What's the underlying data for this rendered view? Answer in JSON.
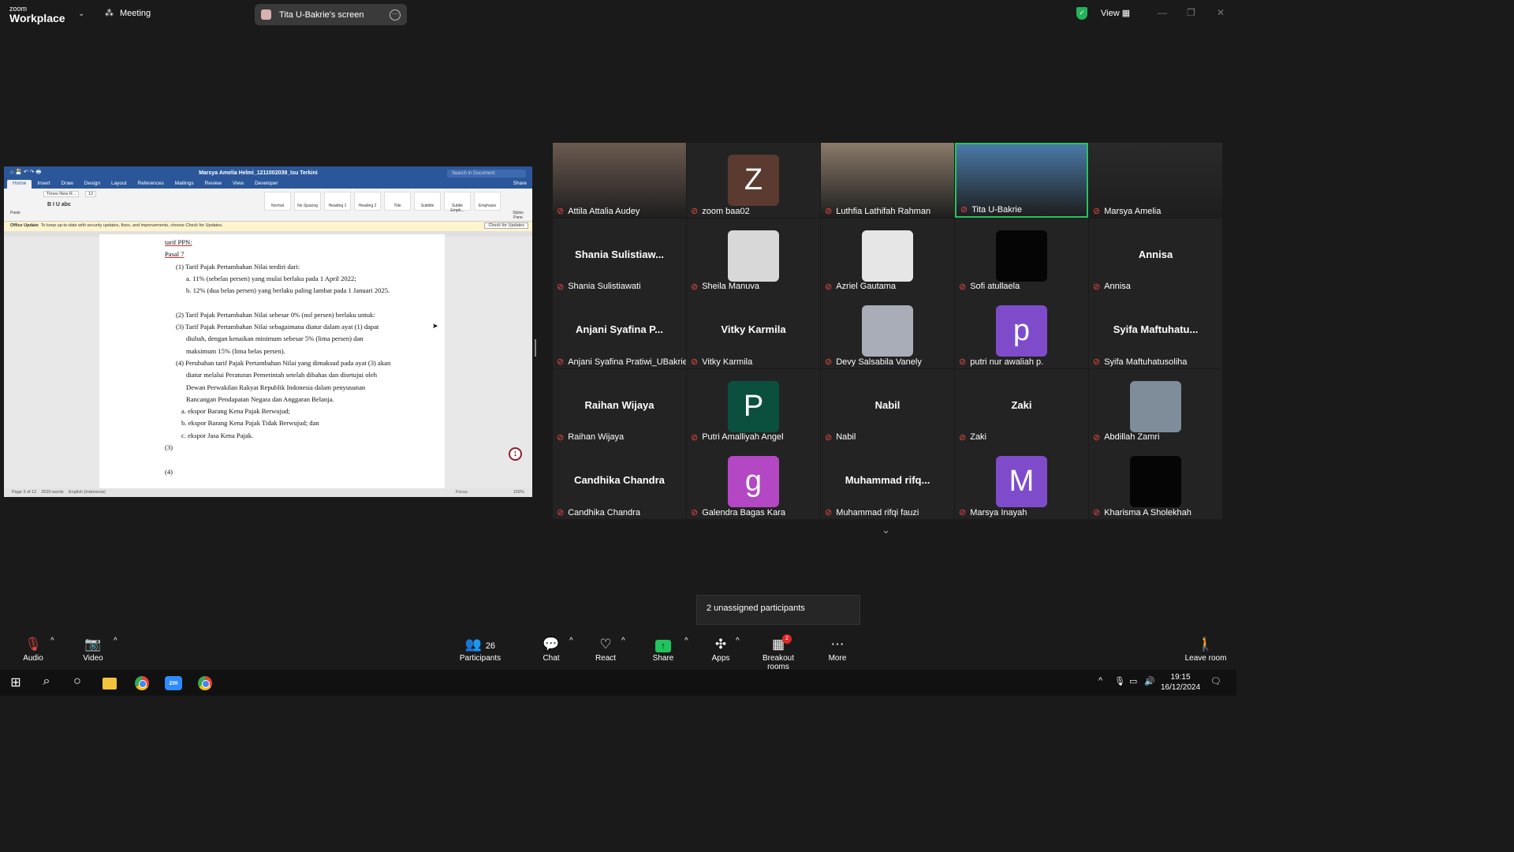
{
  "app": {
    "logo_small": "zoom",
    "logo_big": "Workplace",
    "meeting_label": "Meeting",
    "screen_label": "Tita U-Bakrie's screen",
    "view_label": "View"
  },
  "word": {
    "doc_title": "Marsya Amelia Helmi_1211002039_Isu Terkini",
    "search_placeholder": "Search in Document",
    "share_label": "Share",
    "tabs": [
      "Home",
      "Insert",
      "Draw",
      "Design",
      "Layout",
      "References",
      "Mailings",
      "Review",
      "View",
      "Developer"
    ],
    "font": "Times New R...",
    "size": "12",
    "styles": [
      "Normal",
      "No Spacing",
      "Heading 1",
      "Heading 2",
      "Title",
      "Subtitle",
      "Subtle Emph...",
      "Emphasis"
    ],
    "styles_pane": "Styles Pane",
    "paste": "Paste",
    "update_label": "Office Update",
    "update_text": "To keep up-to-date with security updates, fixes, and improvements, choose Check for Updates.",
    "update_button": "Check for Updates",
    "status_page": "Page 3 of 12",
    "status_words": "2520 words",
    "status_lang": "English (Indonesia)",
    "status_focus": "Focus",
    "status_zoom": "159%",
    "badge": "1",
    "lines": [
      "tarif PPN:",
      "Pasal 7",
      "(1) Tarif Pajak Pertambahan Nilai terdiri dari:",
      "a. 11% (sebelas persen) yang mulai berlaku pada 1 April 2022;",
      "b. 12% (dua belas persen) yang berlaku paling lambat pada 1 Januari 2025.",
      "(2) Tarif Pajak Pertambahan Nilai sebesar 0% (nol persen) berlaku untuk:",
      "(3) Tarif Pajak Pertambahan Nilai sebagaimana diatur dalam ayat (1) dapat",
      "diubah, dengan kenaikan minimum sebesar 5% (lima persen) dan",
      "maksimum 15% (lima belas persen).",
      "(4) Perubahan tarif Pajak Pertambahan Nilai yang dimaksud pada ayat (3) akan",
      "diatur melalui Peraturan Pemerintah setelah dibahas dan disetujui oleh",
      "Dewan Perwakilan Rakyat Republik Indonesia dalam penyusunan",
      "Rancangan Pendapatan Negara dan Anggaran Belanja.",
      "a. ekspor Barang Kena Pajak Berwujud;",
      "b. ekspor Barang Kena Pajak Tidak Berwujud; dan",
      "c. ekspor Jasa Kena Pajak.",
      "(3)",
      "(4)"
    ]
  },
  "participants": [
    {
      "name": "Attila Attalia Audey",
      "kind": "photo",
      "color": "#6b5a50"
    },
    {
      "name": "zoom baa02",
      "kind": "letter",
      "letter": "Z",
      "color": "#5b3a30"
    },
    {
      "name": "Luthfia Lathifah Rahman",
      "kind": "photo",
      "color": "#8a7a6a"
    },
    {
      "name": "Tita U-Bakrie",
      "kind": "photo",
      "color": "#4a7aa8",
      "speaking": true
    },
    {
      "name": "Marsya Amelia",
      "kind": "photo",
      "color": "#2a2a2a"
    },
    {
      "name": "Shania Sulistiawati",
      "kind": "name",
      "display": "Shania  Sulistiaw..."
    },
    {
      "name": "Sheila Manuva",
      "kind": "letter",
      "letter": "",
      "color": "#d8d8d8"
    },
    {
      "name": "Azriel Gautama",
      "kind": "letter",
      "letter": "",
      "color": "#e6e6e6"
    },
    {
      "name": "Sofi atullaela",
      "kind": "letter",
      "letter": "",
      "color": "#050505"
    },
    {
      "name": "Annisa",
      "kind": "name",
      "display": "Annisa"
    },
    {
      "name": "Anjani Syafina Pratiwi_UBakrie",
      "kind": "name",
      "display": "Anjani  Syafina  P..."
    },
    {
      "name": "Vitky Karmila",
      "kind": "name",
      "display": "Vitky Karmila"
    },
    {
      "name": "Devy Salsabila Vanely",
      "kind": "letter",
      "letter": "",
      "color": "#a8adb8"
    },
    {
      "name": "putri nur awaliah p.",
      "kind": "letter",
      "letter": "p",
      "color": "#7e4ccb"
    },
    {
      "name": "Syifa Maftuhatusoliha",
      "kind": "name",
      "display": "Syifa  Maftuhatu..."
    },
    {
      "name": "Raihan Wijaya",
      "kind": "name",
      "display": "Raihan Wijaya"
    },
    {
      "name": "Putri Amalliyah Angel",
      "kind": "letter",
      "letter": "P",
      "color": "#0b4f3f"
    },
    {
      "name": "Nabil",
      "kind": "name",
      "display": "Nabil"
    },
    {
      "name": "Zaki",
      "kind": "name",
      "display": "Zaki"
    },
    {
      "name": "Abdillah Zamri",
      "kind": "letter",
      "letter": "",
      "color": "#7f8c99"
    },
    {
      "name": "Candhika Chandra",
      "kind": "name",
      "display": "Candhika Chandra"
    },
    {
      "name": "Galendra Bagas Kara",
      "kind": "letter",
      "letter": "g",
      "color": "#b347c4"
    },
    {
      "name": "Muhammad rifqi fauzi",
      "kind": "name",
      "display": "Muhammad  rifq..."
    },
    {
      "name": "Marsya Inayah",
      "kind": "letter",
      "letter": "M",
      "color": "#7e4ccb"
    },
    {
      "name": "Kharisma A Sholekhah",
      "kind": "letter",
      "letter": "",
      "color": "#050505"
    }
  ],
  "unassigned": "2 unassigned participants",
  "toolbar": {
    "audio": "Audio",
    "video": "Video",
    "participants": "Participants",
    "participants_count": "26",
    "chat": "Chat",
    "react": "React",
    "share": "Share",
    "apps": "Apps",
    "breakout": "Breakout rooms",
    "breakout_badge": "2",
    "more": "More",
    "leave": "Leave room"
  },
  "taskbar": {
    "time": "19:15",
    "date": "16/12/2024"
  },
  "colors": {
    "speaking_border": "#25c560",
    "muted": "#e8483f",
    "word_blue": "#2b579a"
  }
}
